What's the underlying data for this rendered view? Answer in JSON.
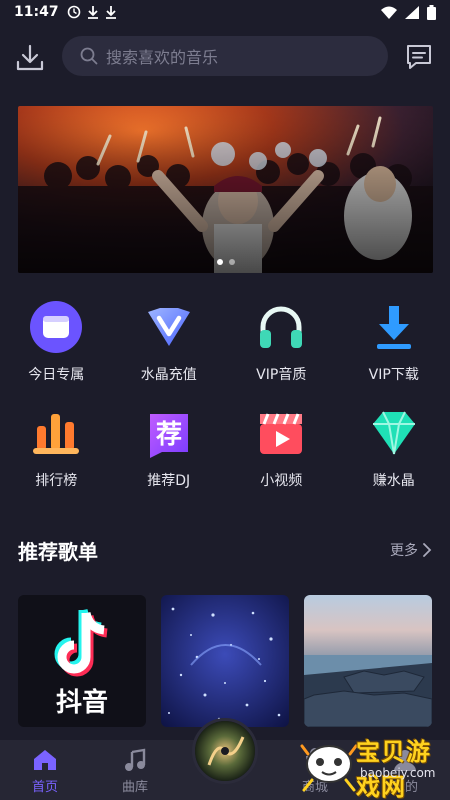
{
  "status_bar": {
    "time": "11:47"
  },
  "search": {
    "placeholder": "搜索喜欢的音乐"
  },
  "grid": [
    {
      "label": "今日专属",
      "icon": "calendar-card-icon"
    },
    {
      "label": "水晶充值",
      "icon": "crystal-v-icon"
    },
    {
      "label": "VIP音质",
      "icon": "headphones-icon"
    },
    {
      "label": "VIP下载",
      "icon": "download-icon"
    },
    {
      "label": "排行榜",
      "icon": "chart-bars-icon"
    },
    {
      "label": "推荐DJ",
      "icon": "recommend-badge-icon",
      "badge": "荐"
    },
    {
      "label": "小视频",
      "icon": "video-clapper-icon"
    },
    {
      "label": "赚水晶",
      "icon": "diamond-icon"
    }
  ],
  "section": {
    "title": "推荐歌单",
    "more": "更多"
  },
  "playlists": [
    {
      "brand": "抖音"
    },
    {
      "overlay": ""
    },
    {
      "overlay": ""
    }
  ],
  "tabs": [
    {
      "label": "首页",
      "icon": "home-icon",
      "active": true
    },
    {
      "label": "曲库",
      "icon": "music-note-icon",
      "active": false
    },
    {
      "label": "",
      "icon": "disc-icon",
      "active": false
    },
    {
      "label": "商城",
      "icon": "shop-icon",
      "active": false
    },
    {
      "label": "我的",
      "icon": "profile-icon",
      "active": false
    }
  ],
  "watermark": {
    "title": "宝贝游戏网",
    "url": "baobeiy.com"
  },
  "colors": {
    "background": "#1c1c2a",
    "accent": "#7a63ff",
    "tab_bar": "#262634"
  }
}
